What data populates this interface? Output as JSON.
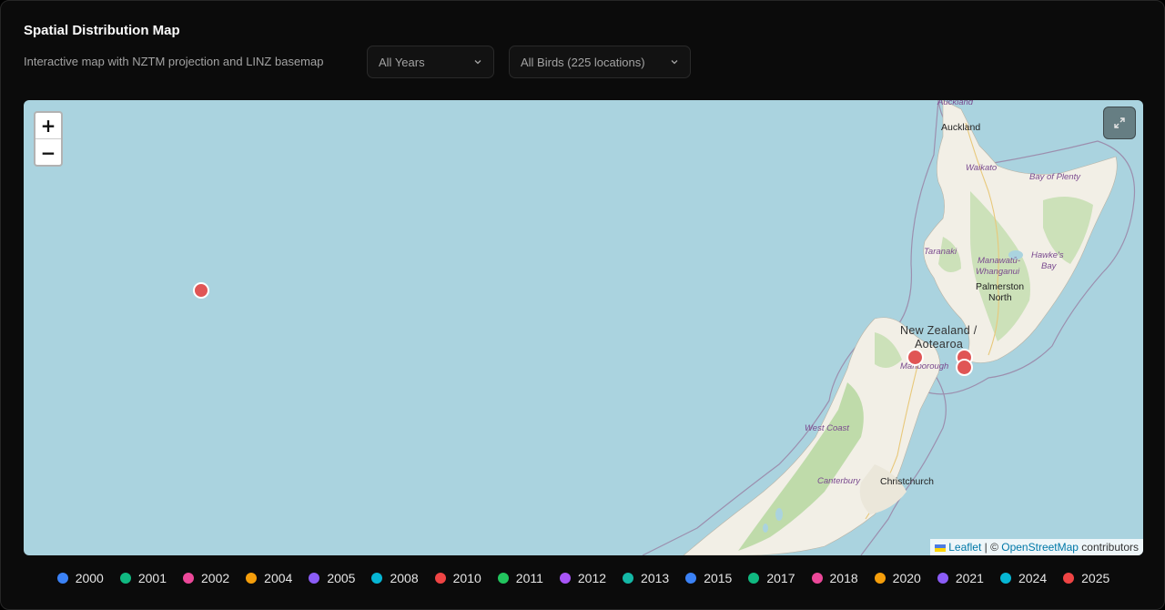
{
  "header": {
    "title": "Spatial Distribution Map",
    "subtitle": "Interactive map with NZTM projection and LINZ basemap"
  },
  "filters": {
    "year": {
      "selected": "All Years"
    },
    "birds": {
      "selected": "All Birds (225 locations)"
    }
  },
  "map": {
    "zoom_in": "+",
    "zoom_out": "−",
    "labels": {
      "auckland_region": "Auckland",
      "auckland": "Auckland",
      "waikato": "Waikato",
      "bay_of_plenty": "Bay of Plenty",
      "taranaki": "Taranaki",
      "hawkes_bay_1": "Hawke's",
      "hawkes_bay_2": "Bay",
      "manawatu_1": "Manawatū-",
      "manawatu_2": "Whanganui",
      "palmerston_1": "Palmerston",
      "palmerston_2": "North",
      "nz_1": "New Zealand /",
      "nz_2": "Aotearoa",
      "marlborough": "Marlborough",
      "west_coast": "West Coast",
      "canterbury": "Canterbury",
      "christchurch": "Christchurch"
    },
    "attribution": {
      "leaflet": "Leaflet",
      "sep": " | © ",
      "osm": "OpenStreetMap",
      "contrib": " contributors"
    },
    "point_color": "#e05555"
  },
  "legend": [
    {
      "label": "2000",
      "color": "#3b82f6"
    },
    {
      "label": "2001",
      "color": "#10b981"
    },
    {
      "label": "2002",
      "color": "#ec4899"
    },
    {
      "label": "2004",
      "color": "#f59e0b"
    },
    {
      "label": "2005",
      "color": "#8b5cf6"
    },
    {
      "label": "2008",
      "color": "#06b6d4"
    },
    {
      "label": "2010",
      "color": "#ef4444"
    },
    {
      "label": "2011",
      "color": "#22c55e"
    },
    {
      "label": "2012",
      "color": "#a855f7"
    },
    {
      "label": "2013",
      "color": "#14b8a6"
    },
    {
      "label": "2015",
      "color": "#3b82f6"
    },
    {
      "label": "2017",
      "color": "#10b981"
    },
    {
      "label": "2018",
      "color": "#ec4899"
    },
    {
      "label": "2020",
      "color": "#f59e0b"
    },
    {
      "label": "2021",
      "color": "#8b5cf6"
    },
    {
      "label": "2024",
      "color": "#06b6d4"
    },
    {
      "label": "2025",
      "color": "#ef4444"
    }
  ]
}
